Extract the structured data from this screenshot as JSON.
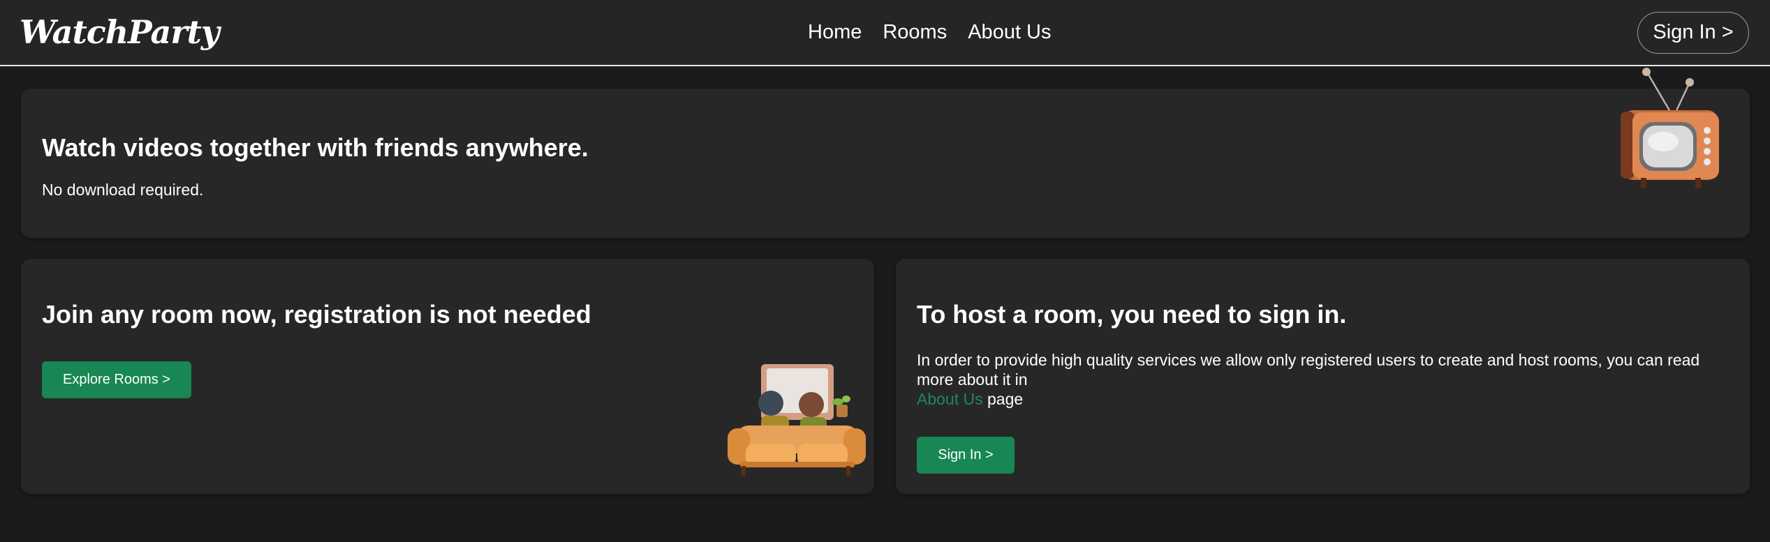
{
  "navbar": {
    "logo": "WatchParty",
    "links": [
      "Home",
      "Rooms",
      "About Us"
    ],
    "sign_in": "Sign In >"
  },
  "hero": {
    "title": "Watch videos together with friends anywhere.",
    "subtitle": "No download required.",
    "image_icon": "retro-tv-icon"
  },
  "join": {
    "title": "Join any room now, registration is not needed",
    "button": "Explore Rooms >",
    "image_icon": "couch-watching-tv-icon"
  },
  "host": {
    "title": "To host a room, you need to sign in.",
    "description": "In order to provide high quality services we allow only registered users to create and host rooms, you can read more about it in",
    "link_text": "About Us",
    "after_link": " page",
    "button": "Sign In >"
  },
  "colors": {
    "background": "#1b1b1b",
    "card": "#272727",
    "accent": "#198754",
    "link": "#1c8a57"
  }
}
